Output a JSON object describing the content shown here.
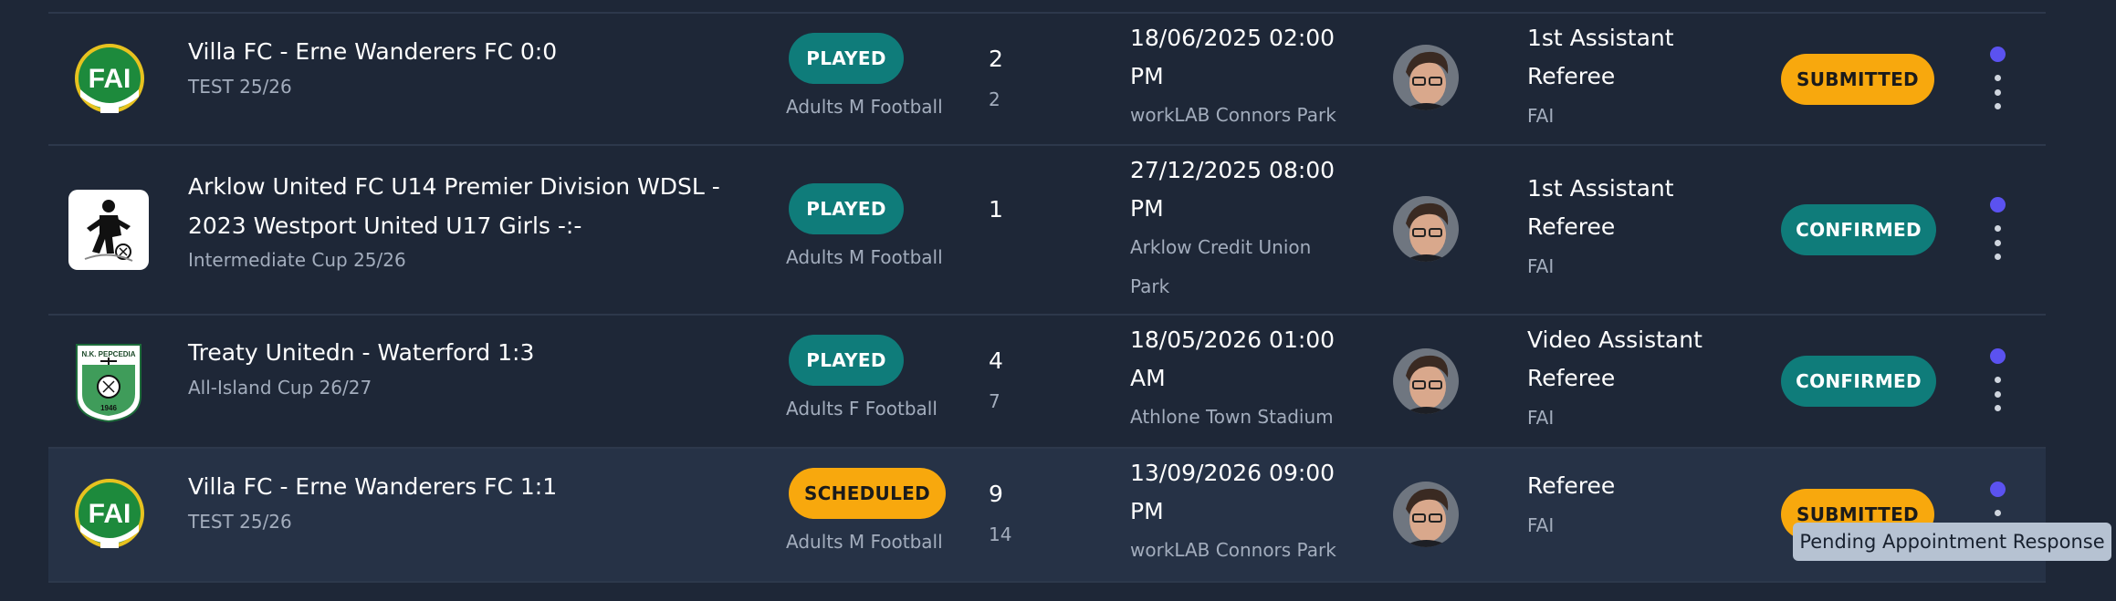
{
  "rows": [
    {
      "logo": "fai-logo",
      "title_lines": [
        "Villa FC - Erne Wanderers FC 0:0"
      ],
      "competition": "TEST 25/26",
      "status": "PLAYED",
      "category": "Adults M Football",
      "num_main": "2",
      "num_sub": "2",
      "datetime_lines": [
        "18/06/2025 02:00",
        "PM"
      ],
      "venue_lines": [
        "workLAB Connors Park"
      ],
      "role_lines": [
        "1st Assistant",
        "Referee"
      ],
      "org": "FAI",
      "report_status": "SUBMITTED"
    },
    {
      "logo": "arklow-logo",
      "title_lines": [
        "Arklow United FC U14 Premier Division WDSL -",
        "2023 Westport United U17 Girls -:-"
      ],
      "competition": "Intermediate Cup 25/26",
      "status": "PLAYED",
      "category": "Adults M Football",
      "num_main": "1",
      "num_sub": "",
      "datetime_lines": [
        "27/12/2025 08:00",
        "PM"
      ],
      "venue_lines": [
        "Arklow Credit Union",
        "Park"
      ],
      "role_lines": [
        "1st Assistant",
        "Referee"
      ],
      "org": "FAI",
      "report_status": "CONFIRMED"
    },
    {
      "logo": "pepcedia-crest",
      "title_lines": [
        "Treaty Unitedn - Waterford 1:3"
      ],
      "competition": "All-Island Cup 26/27",
      "status": "PLAYED",
      "category": "Adults F Football",
      "num_main": "4",
      "num_sub": "7",
      "datetime_lines": [
        "18/05/2026 01:00",
        "AM"
      ],
      "venue_lines": [
        "Athlone Town Stadium"
      ],
      "role_lines": [
        "Video Assistant",
        "Referee"
      ],
      "org": "FAI",
      "report_status": "CONFIRMED"
    },
    {
      "logo": "fai-logo",
      "title_lines": [
        "Villa FC - Erne Wanderers FC 1:1"
      ],
      "competition": "TEST 25/26",
      "status": "SCHEDULED",
      "category": "Adults M Football",
      "num_main": "9",
      "num_sub": "14",
      "datetime_lines": [
        "13/09/2026 09:00",
        "PM"
      ],
      "venue_lines": [
        "workLAB Connors Park"
      ],
      "role_lines": [
        "Referee"
      ],
      "org": "FAI",
      "report_status": "SUBMITTED"
    }
  ],
  "logo_text": {
    "fai": "FAI",
    "crest_top": "N.K. PEPCEDIA",
    "crest_year": "1946"
  },
  "tooltip": "Pending Appointment Response",
  "colors": {
    "background": "#1e2737",
    "row_hover": "#263246",
    "teal": "#0f7c7a",
    "amber": "#f8a80d",
    "indicator": "#5b52f0",
    "fai_green": "#1d8a3c"
  }
}
